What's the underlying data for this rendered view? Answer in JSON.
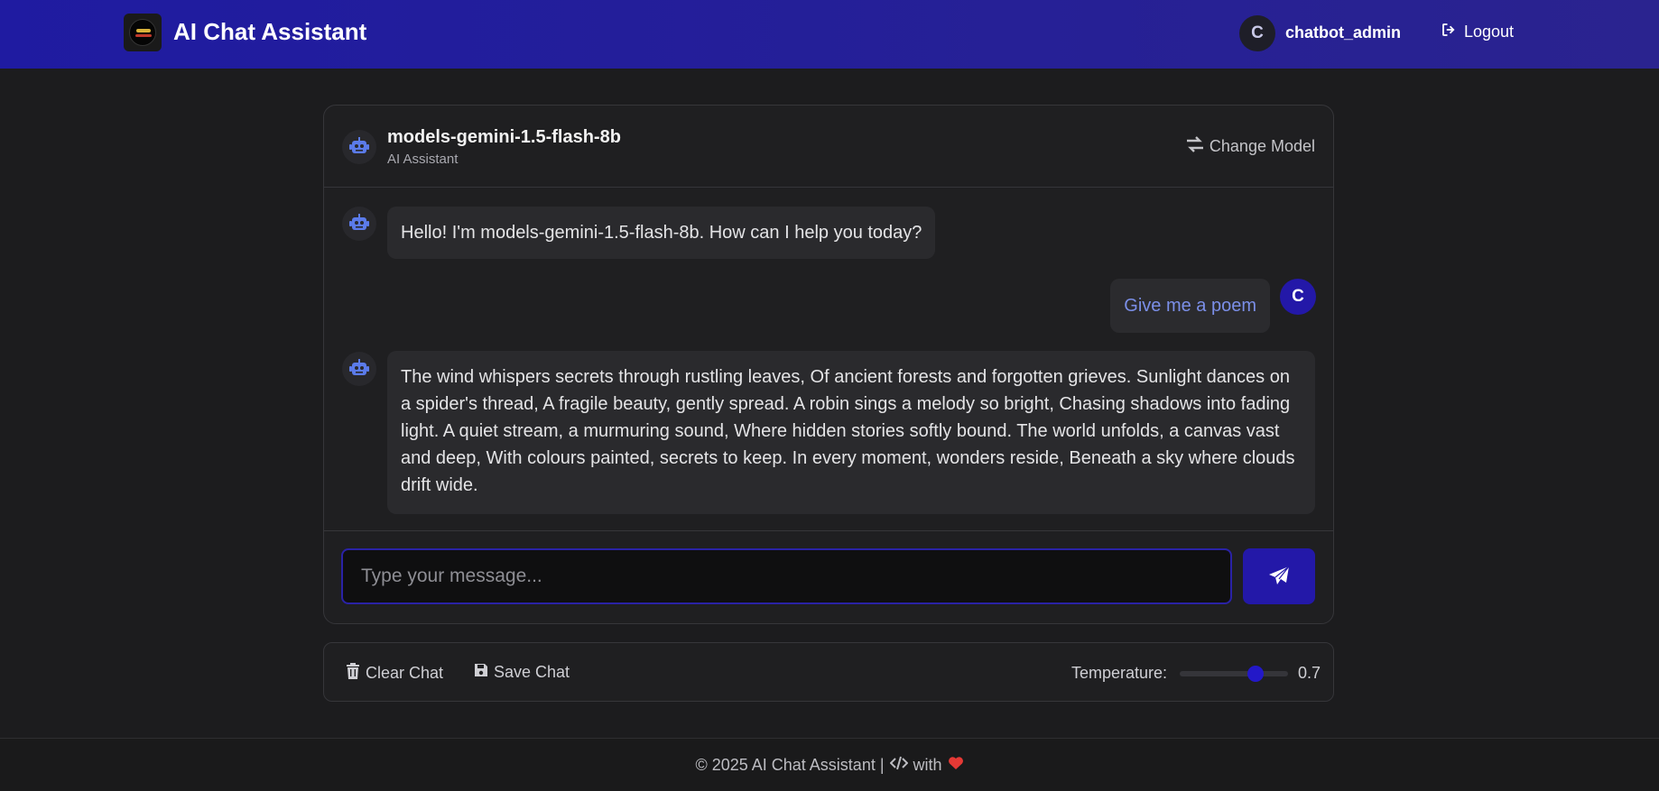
{
  "header": {
    "brand": "AI Chat Assistant",
    "user_initial": "C",
    "username": "chatbot_admin",
    "logout_label": "Logout"
  },
  "chat": {
    "model_name": "models-gemini-1.5-flash-8b",
    "model_subtitle": "AI Assistant",
    "change_model_label": "Change Model",
    "messages": [
      {
        "role": "bot",
        "text": "Hello! I'm models-gemini-1.5-flash-8b. How can I help you today?"
      },
      {
        "role": "user",
        "initial": "C",
        "text": "Give me a poem"
      },
      {
        "role": "bot",
        "text": "The wind whispers secrets through rustling leaves, Of ancient forests and forgotten grieves. Sunlight dances on a spider's thread, A fragile beauty, gently spread. A robin sings a melody so bright, Chasing shadows into fading light. A quiet stream, a murmuring sound, Where hidden stories softly bound. The world unfolds, a canvas vast and deep, With colours painted, secrets to keep. In every moment, wonders reside, Beneath a sky where clouds drift wide."
      }
    ],
    "input_placeholder": "Type your message...",
    "input_value": ""
  },
  "toolbar": {
    "clear_label": "Clear Chat",
    "save_label": "Save Chat",
    "temperature_label": "Temperature:",
    "temperature_value": "0.7",
    "temperature_fraction": 0.7
  },
  "footer": {
    "copyright": "© 2025 AI Chat Assistant |",
    "with_label": "with"
  },
  "colors": {
    "accent": "#2318a8",
    "bot_icon": "#5b7bea",
    "heart": "#e53935"
  }
}
